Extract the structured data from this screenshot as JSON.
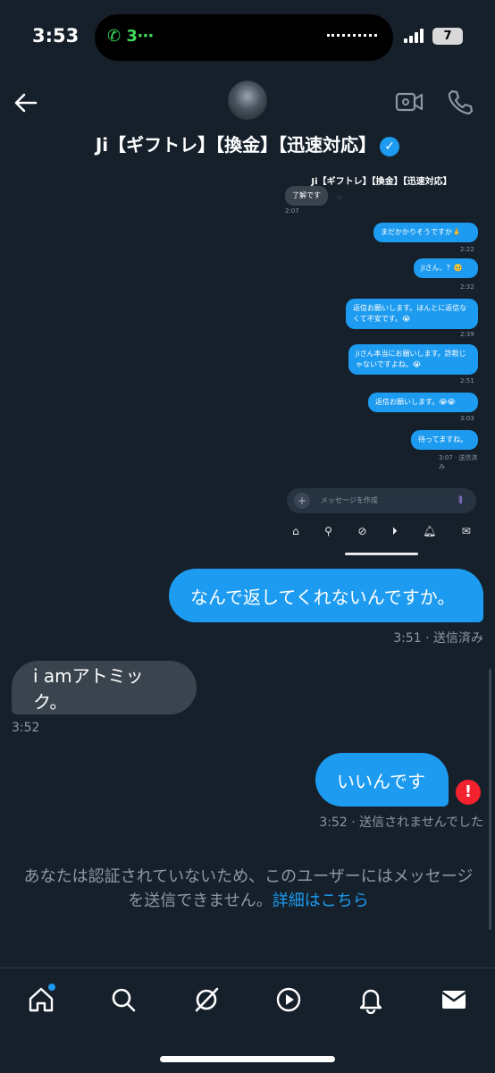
{
  "status_bar": {
    "time": "3:53",
    "call_indicator": "3⋯",
    "battery": "7"
  },
  "header": {
    "title": "Ji【ギフトレ】【換金】【迅速対応】"
  },
  "embedded_screenshot": {
    "title": "Ji【ギフトレ】【換金】【迅速対応】",
    "messages": [
      {
        "text": "了解です",
        "time": "2:07",
        "dir": "in"
      },
      {
        "text": "まだかかりそうですか🙏",
        "time": "2:22",
        "dir": "out"
      },
      {
        "text": "jiさん、？🥺",
        "time": "2:32",
        "dir": "out"
      },
      {
        "text": "返信お願いします。ほんとに返信なくて不安です。😭",
        "time": "2:39",
        "dir": "out"
      },
      {
        "text": "jiさん本当にお願いします。詐欺じゃないですよね。😭",
        "time": "2:51",
        "dir": "out"
      },
      {
        "text": "返信お願いします。😭😭",
        "time": "3:03",
        "dir": "out"
      },
      {
        "text": "待ってますね。",
        "time": "3:07 · 送信済み",
        "dir": "out"
      }
    ],
    "compose_placeholder": "メッセージを作成"
  },
  "messages": [
    {
      "text": "なんで返してくれないんですか。",
      "meta": "3:51 · 送信済み",
      "dir": "out"
    },
    {
      "text": "i amアトミック。",
      "meta": "3:52",
      "dir": "in"
    },
    {
      "text": "いいんです",
      "meta": "3:52 · 送信されませんでした",
      "dir": "out"
    }
  ],
  "error_icon": "!",
  "notice": {
    "text": "あなたは認証されていないため、このユーザーにはメッセージを送信できません。",
    "link": "詳細はこちら"
  },
  "nav": {
    "items": [
      "home-icon",
      "search-icon",
      "grok-icon",
      "video-icon",
      "bell-icon",
      "mail-icon"
    ]
  },
  "colors": {
    "background": "#15202b",
    "accent": "#1d9bf0",
    "error": "#f4212e"
  }
}
